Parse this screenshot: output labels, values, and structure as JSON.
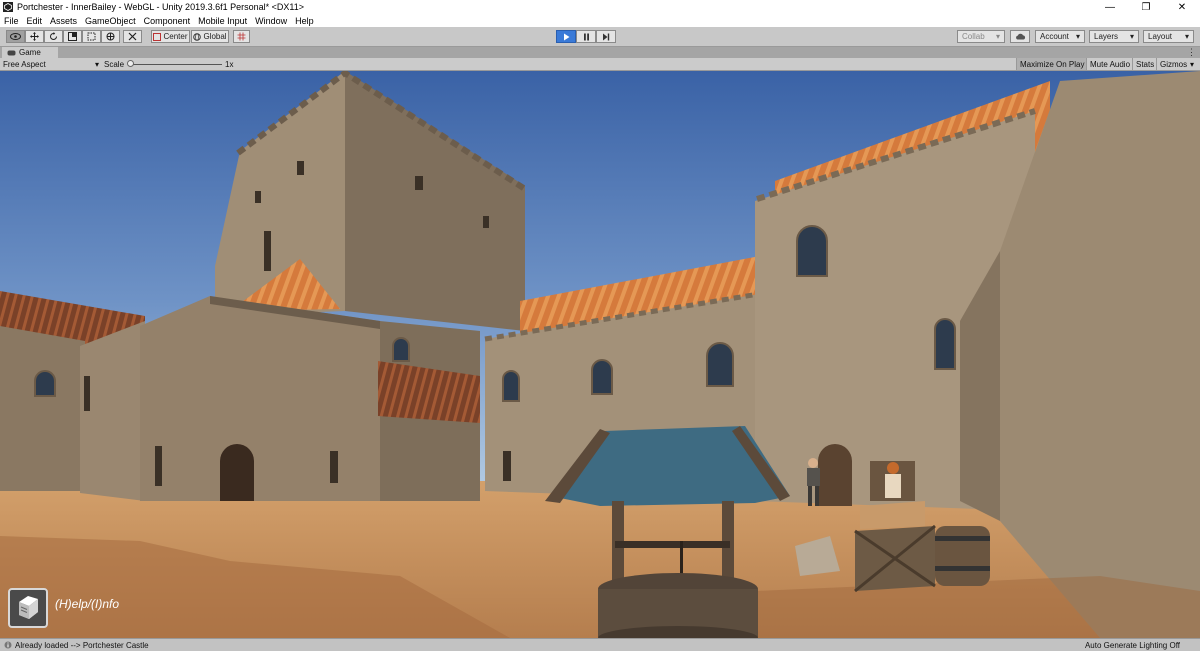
{
  "window": {
    "title": "Portchester - InnerBailey - WebGL - Unity 2019.3.6f1 Personal* <DX11>",
    "controls": {
      "minimize": "—",
      "maximize": "❐",
      "close": "✕"
    }
  },
  "menu": [
    "File",
    "Edit",
    "Assets",
    "GameObject",
    "Component",
    "Mobile Input",
    "Window",
    "Help"
  ],
  "toolbar": {
    "pivot_label": "Center",
    "space_label": "Global",
    "collab_label": "Collab",
    "account_label": "Account",
    "layers_label": "Layers",
    "layout_label": "Layout"
  },
  "game_panel": {
    "tab_label": "Game",
    "aspect_label": "Free Aspect",
    "scale_label": "Scale",
    "scale_value": "1x",
    "maximize_on_play": "Maximize On Play",
    "mute_audio": "Mute Audio",
    "stats": "Stats",
    "gizmos": "Gizmos"
  },
  "overlay": {
    "help_text": "(H)elp/(I)nfo"
  },
  "status": {
    "message": "Already loaded --> Portchester Castle",
    "lighting": "Auto Generate Lighting Off"
  },
  "colors": {
    "sky_top": "#3f66a8",
    "sky_bottom": "#a9c3df",
    "ground": "#d9a46c",
    "stone": "#9c8a72",
    "roof": "#d4773a",
    "play_accent": "#3a7ad8"
  }
}
